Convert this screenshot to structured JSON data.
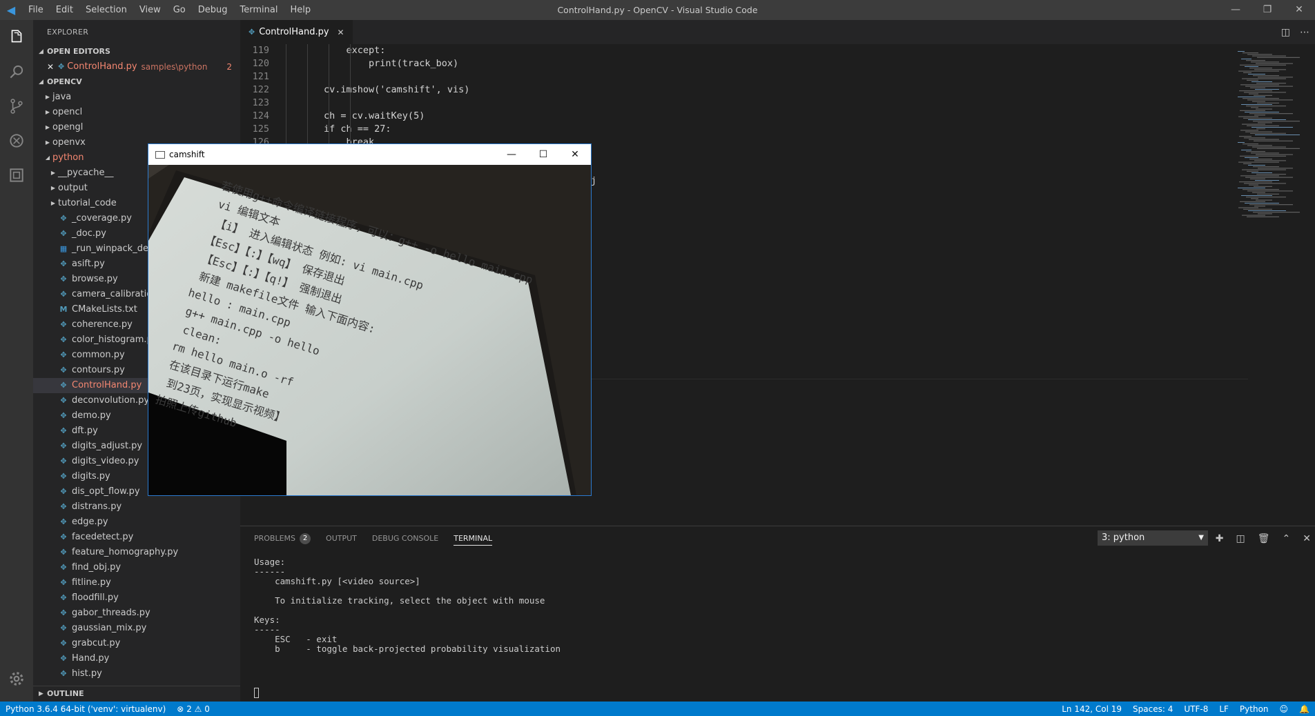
{
  "titlebar": {
    "menu": [
      "File",
      "Edit",
      "Selection",
      "View",
      "Go",
      "Debug",
      "Terminal",
      "Help"
    ],
    "window_title": "ControlHand.py - OpenCV - Visual Studio Code"
  },
  "activitybar": {
    "icons": [
      "files-icon",
      "search-icon",
      "source-control-icon",
      "debug-icon",
      "extensions-icon",
      "gear-icon"
    ]
  },
  "sidebar": {
    "title": "EXPLORER",
    "open_editors_header": "OPEN EDITORS",
    "open_editor": {
      "name": "ControlHand.py",
      "path": "samples\\python",
      "count": "2"
    },
    "project_header": "OPENCV",
    "tree": [
      {
        "label": "java",
        "type": "folder",
        "depth": 1,
        "open": false
      },
      {
        "label": "opencl",
        "type": "folder",
        "depth": 1,
        "open": false
      },
      {
        "label": "opengl",
        "type": "folder",
        "depth": 1,
        "open": false
      },
      {
        "label": "openvx",
        "type": "folder",
        "depth": 1,
        "open": false
      },
      {
        "label": "python",
        "type": "folder",
        "depth": 1,
        "open": true
      },
      {
        "label": "__pycache__",
        "type": "folder",
        "depth": 2,
        "open": false
      },
      {
        "label": "output",
        "type": "folder",
        "depth": 2,
        "open": false
      },
      {
        "label": "tutorial_code",
        "type": "folder",
        "depth": 2,
        "open": false
      },
      {
        "label": "_coverage.py",
        "type": "py",
        "depth": 2
      },
      {
        "label": "_doc.py",
        "type": "py",
        "depth": 2
      },
      {
        "label": "_run_winpack_demo",
        "type": "win",
        "depth": 2
      },
      {
        "label": "asift.py",
        "type": "py",
        "depth": 2
      },
      {
        "label": "browse.py",
        "type": "py",
        "depth": 2
      },
      {
        "label": "camera_calibration_s",
        "type": "py",
        "depth": 2
      },
      {
        "label": "CMakeLists.txt",
        "type": "md",
        "depth": 2
      },
      {
        "label": "coherence.py",
        "type": "py",
        "depth": 2
      },
      {
        "label": "color_histogram.py",
        "type": "py",
        "depth": 2
      },
      {
        "label": "common.py",
        "type": "py",
        "depth": 2
      },
      {
        "label": "contours.py",
        "type": "py",
        "depth": 2
      },
      {
        "label": "ControlHand.py",
        "type": "py",
        "depth": 2,
        "selected": true
      },
      {
        "label": "deconvolution.py",
        "type": "py",
        "depth": 2
      },
      {
        "label": "demo.py",
        "type": "py",
        "depth": 2
      },
      {
        "label": "dft.py",
        "type": "py",
        "depth": 2
      },
      {
        "label": "digits_adjust.py",
        "type": "py",
        "depth": 2
      },
      {
        "label": "digits_video.py",
        "type": "py",
        "depth": 2
      },
      {
        "label": "digits.py",
        "type": "py",
        "depth": 2
      },
      {
        "label": "dis_opt_flow.py",
        "type": "py",
        "depth": 2
      },
      {
        "label": "distrans.py",
        "type": "py",
        "depth": 2
      },
      {
        "label": "edge.py",
        "type": "py",
        "depth": 2
      },
      {
        "label": "facedetect.py",
        "type": "py",
        "depth": 2
      },
      {
        "label": "feature_homography.py",
        "type": "py",
        "depth": 2
      },
      {
        "label": "find_obj.py",
        "type": "py",
        "depth": 2
      },
      {
        "label": "fitline.py",
        "type": "py",
        "depth": 2
      },
      {
        "label": "floodfill.py",
        "type": "py",
        "depth": 2
      },
      {
        "label": "gabor_threads.py",
        "type": "py",
        "depth": 2
      },
      {
        "label": "gaussian_mix.py",
        "type": "py",
        "depth": 2
      },
      {
        "label": "grabcut.py",
        "type": "py",
        "depth": 2
      },
      {
        "label": "Hand.py",
        "type": "py",
        "depth": 2
      },
      {
        "label": "hist.py",
        "type": "py",
        "depth": 2
      }
    ],
    "outline_header": "OUTLINE"
  },
  "editor": {
    "tab": "ControlHand.py",
    "lines": [
      {
        "n": "119",
        "text": "            except:"
      },
      {
        "n": "120",
        "text": "                print(track_box)"
      },
      {
        "n": "121",
        "text": ""
      },
      {
        "n": "122",
        "text": "        cv.imshow('camshift', vis)"
      },
      {
        "n": "123",
        "text": ""
      },
      {
        "n": "124",
        "text": "        ch = cv.waitKey(5)"
      },
      {
        "n": "125",
        "text": "        if ch == 27:"
      },
      {
        "n": "126",
        "text": "            break"
      }
    ],
    "hidden_fragment": "j"
  },
  "panel": {
    "tabs": [
      "PROBLEMS",
      "OUTPUT",
      "DEBUG CONSOLE",
      "TERMINAL"
    ],
    "problems_count": "2",
    "active_tab": "TERMINAL",
    "terminal_select": "3: python",
    "terminal_lines": [
      "Usage:",
      "------",
      "    camshift.py [<video source>]",
      "",
      "    To initialize tracking, select the object with mouse",
      "",
      "Keys:",
      "-----",
      "    ESC   - exit",
      "    b     - toggle back-projected probability visualization"
    ]
  },
  "statusbar": {
    "interpreter": "Python 3.6.4 64-bit ('venv': virtualenv)",
    "errors": "2",
    "warnings": "0",
    "position": "Ln 142, Col 19",
    "spaces": "Spaces: 4",
    "encoding": "UTF-8",
    "eol": "LF",
    "language": "Python"
  },
  "camshift_window": {
    "title": "camshift",
    "video_text": [
      "若使用g++命令编译链接程序，可以：g++ -o hello main.cpp",
      "vi  编辑文本",
      "【i】  进入编辑状态   例如: vi main.cpp",
      "【Esc】【:】【wq】 保存退出",
      "【Esc】【:】【q!】 强制退出",
      "新建 makefile文件 输入下面内容:",
      "hello : main.cpp",
      "g++ main.cpp -o hello",
      "clean:",
      "rm hello main.o -rf",
      "在该目录下运行make",
      "到23页，实现显示视频】",
      "拍照上传github"
    ]
  },
  "colors": {
    "accent": "#007acc",
    "error_file": "#f48771",
    "python_icon": "#519aba"
  }
}
